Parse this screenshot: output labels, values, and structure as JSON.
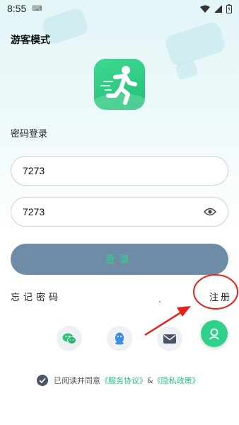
{
  "status_bar": {
    "time": "8:55"
  },
  "header": {
    "guest_mode": "游客模式"
  },
  "login": {
    "section_label": "密码登录",
    "account_value": "7273",
    "password_value": "7273",
    "login_button": "登录",
    "forgot_password": "忘记密码",
    "register": "注册"
  },
  "social": [
    "wechat-icon",
    "qq-icon",
    "mail-icon"
  ],
  "agreement": {
    "prefix": "已阅读并同意",
    "service_link": "《服务协议》",
    "ampersand": "&",
    "privacy_link": "《隐私政策》"
  },
  "colors": {
    "brand_green": "#2fd08a",
    "button_bg": "#6f8ca6",
    "annotation_red": "#e8201a"
  }
}
